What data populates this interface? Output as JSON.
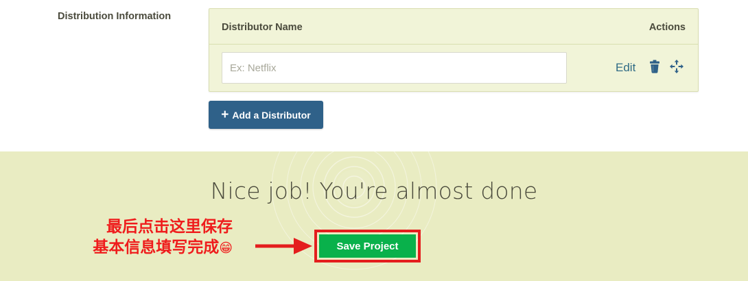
{
  "distribution": {
    "section_label": "Distribution Information",
    "table": {
      "col_name": "Distributor Name",
      "col_actions": "Actions",
      "rows": [
        {
          "name_value": "",
          "name_placeholder": "Ex: Netflix",
          "edit_label": "Edit"
        }
      ]
    },
    "add_button_label": "Add a Distributor"
  },
  "footer": {
    "message": "Nice job! You're almost done",
    "save_button_label": "Save Project"
  },
  "annotation": {
    "line1": "最后点击这里保存",
    "line2": "基本信息填写完成",
    "emoji": "😁",
    "color": "#ef1c1c"
  },
  "icons": [
    "trash-icon",
    "move-icon",
    "plus-icon",
    "arrow-right-icon"
  ],
  "colors": {
    "table_bg": "#f1f4d8",
    "add_button": "#2f6189",
    "footer_bg": "#e9ecc2",
    "save_button": "#09b14b",
    "highlight_border": "#e41d1d",
    "link": "#2f6b85"
  }
}
